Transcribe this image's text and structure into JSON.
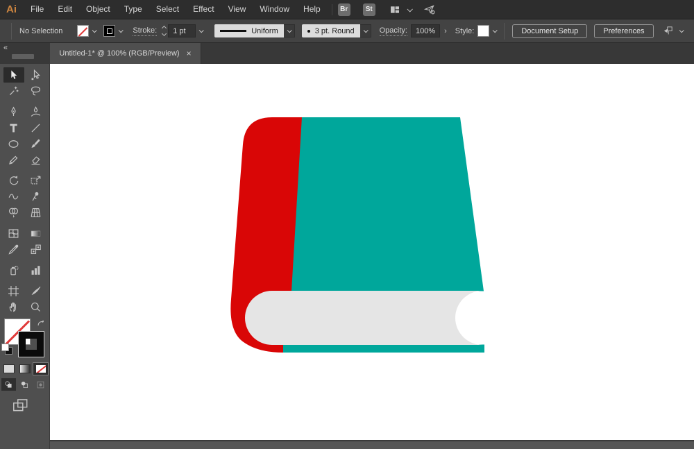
{
  "menubar": {
    "logo": "Ai",
    "items": [
      "File",
      "Edit",
      "Object",
      "Type",
      "Select",
      "Effect",
      "View",
      "Window",
      "Help"
    ],
    "bridge_label": "Br",
    "stock_label": "St"
  },
  "controlbar": {
    "selection_status": "No Selection",
    "stroke_label": "Stroke:",
    "stroke_value": "1 pt",
    "profile_value": "Uniform",
    "brush_value": "3 pt. Round",
    "opacity_label": "Opacity:",
    "opacity_value": "100%",
    "opacity_expand": "›",
    "style_label": "Style:",
    "document_setup_label": "Document Setup",
    "preferences_label": "Preferences"
  },
  "tabbar": {
    "collapse_glyph": "«",
    "tab_title": "Untitled-1* @ 100% (RGB/Preview)",
    "close_glyph": "×"
  },
  "toolbar": {
    "selected_tool": "selection",
    "tool_rows": [
      {
        "tools": [
          "selection",
          "direct-selection"
        ],
        "gap_after": false
      },
      {
        "tools": [
          "magic-wand",
          "lasso"
        ],
        "gap_after": true
      },
      {
        "tools": [
          "pen",
          "curvature"
        ],
        "gap_after": false
      },
      {
        "tools": [
          "type",
          "line-segment"
        ],
        "gap_after": false
      },
      {
        "tools": [
          "ellipse",
          "paintbrush"
        ],
        "gap_after": false
      },
      {
        "tools": [
          "pencil",
          "eraser"
        ],
        "gap_after": true
      },
      {
        "tools": [
          "rotate",
          "scale"
        ],
        "gap_after": false
      },
      {
        "tools": [
          "width",
          "puppet-warp"
        ],
        "gap_after": false
      },
      {
        "tools": [
          "shape-builder",
          "perspective-grid"
        ],
        "gap_after": true
      },
      {
        "tools": [
          "mesh",
          "gradient"
        ],
        "gap_after": false
      },
      {
        "tools": [
          "eyedropper",
          "blend"
        ],
        "gap_after": true
      },
      {
        "tools": [
          "symbol-sprayer",
          "column-graph"
        ],
        "gap_after": true
      },
      {
        "tools": [
          "artboard",
          "slice"
        ],
        "gap_after": false
      },
      {
        "tools": [
          "hand",
          "zoom"
        ],
        "gap_after": false
      }
    ]
  },
  "ui_colors": {
    "menubar_bg": "#2d2d2d",
    "controlbar_bg": "#434343",
    "panel_bg": "#4f4f4f",
    "tab_active_bg": "#4f4f4f",
    "icon_gray": "#c4c4c4",
    "canvas_bg": "#ffffff"
  },
  "canvas": {
    "artwork": "book-illustration",
    "colors": {
      "spine_red": "#d90606",
      "cover_teal": "#00a79b",
      "pages_gray": "#e5e5e5"
    }
  }
}
